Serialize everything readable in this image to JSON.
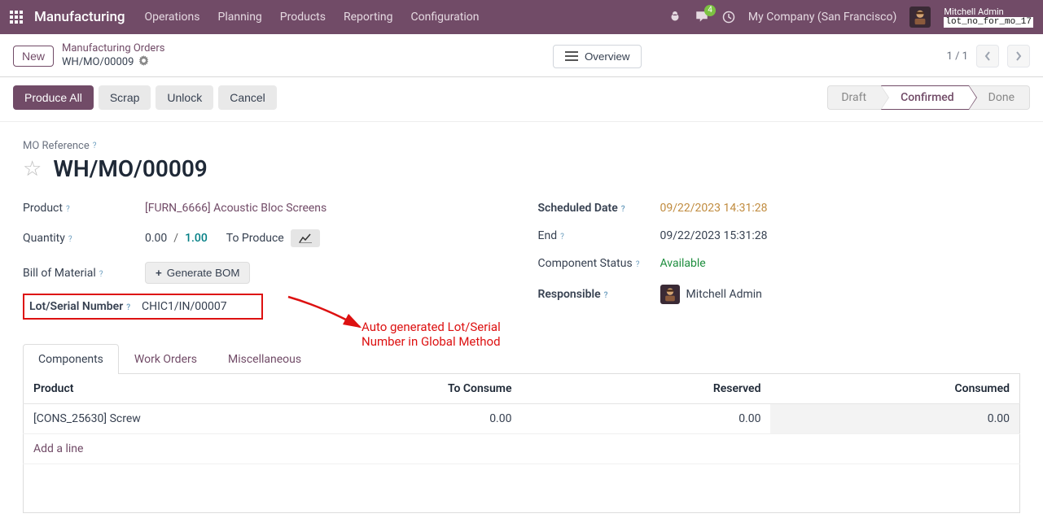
{
  "topbar": {
    "app_name": "Manufacturing",
    "menu": [
      "Operations",
      "Planning",
      "Products",
      "Reporting",
      "Configuration"
    ],
    "messages_badge": "4",
    "company": "My Company (San Francisco)",
    "user_name": "Mitchell Admin",
    "user_sub": "lot_no_for_mo_17"
  },
  "action_bar": {
    "new_label": "New",
    "breadcrumb_parent": "Manufacturing Orders",
    "breadcrumb_current": "WH/MO/00009",
    "overview_label": "Overview",
    "pager": "1 / 1"
  },
  "status_row": {
    "buttons": {
      "produce_all": "Produce All",
      "scrap": "Scrap",
      "unlock": "Unlock",
      "cancel": "Cancel"
    },
    "states": {
      "draft": "Draft",
      "confirmed": "Confirmed",
      "done": "Done"
    }
  },
  "form": {
    "mo_ref_label": "MO Reference",
    "mo_title": "WH/MO/00009",
    "left": {
      "product_label": "Product",
      "product_value": "[FURN_6666] Acoustic Bloc Screens",
      "quantity_label": "Quantity",
      "quantity_done": "0.00",
      "quantity_sep": "/",
      "quantity_total": "1.00",
      "to_produce": "To Produce",
      "bom_label": "Bill of Material",
      "gen_bom": "Generate BOM",
      "lot_label": "Lot/Serial Number",
      "lot_value": "CHIC1/IN/00007"
    },
    "right": {
      "scheduled_label": "Scheduled Date",
      "scheduled_value": "09/22/2023 14:31:28",
      "end_label": "End",
      "end_value": "09/22/2023 15:31:28",
      "component_status_label": "Component Status",
      "component_status_value": "Available",
      "responsible_label": "Responsible",
      "responsible_value": "Mitchell Admin"
    }
  },
  "annotation": "Auto generated Lot/Serial Number in Global Method",
  "tabs": {
    "components": "Components",
    "work_orders": "Work Orders",
    "misc": "Miscellaneous"
  },
  "table": {
    "headers": {
      "product": "Product",
      "to_consume": "To Consume",
      "reserved": "Reserved",
      "consumed": "Consumed"
    },
    "rows": [
      {
        "product": "[CONS_25630] Screw",
        "to_consume": "0.00",
        "reserved": "0.00",
        "consumed": "0.00"
      }
    ],
    "add_line": "Add a line"
  }
}
